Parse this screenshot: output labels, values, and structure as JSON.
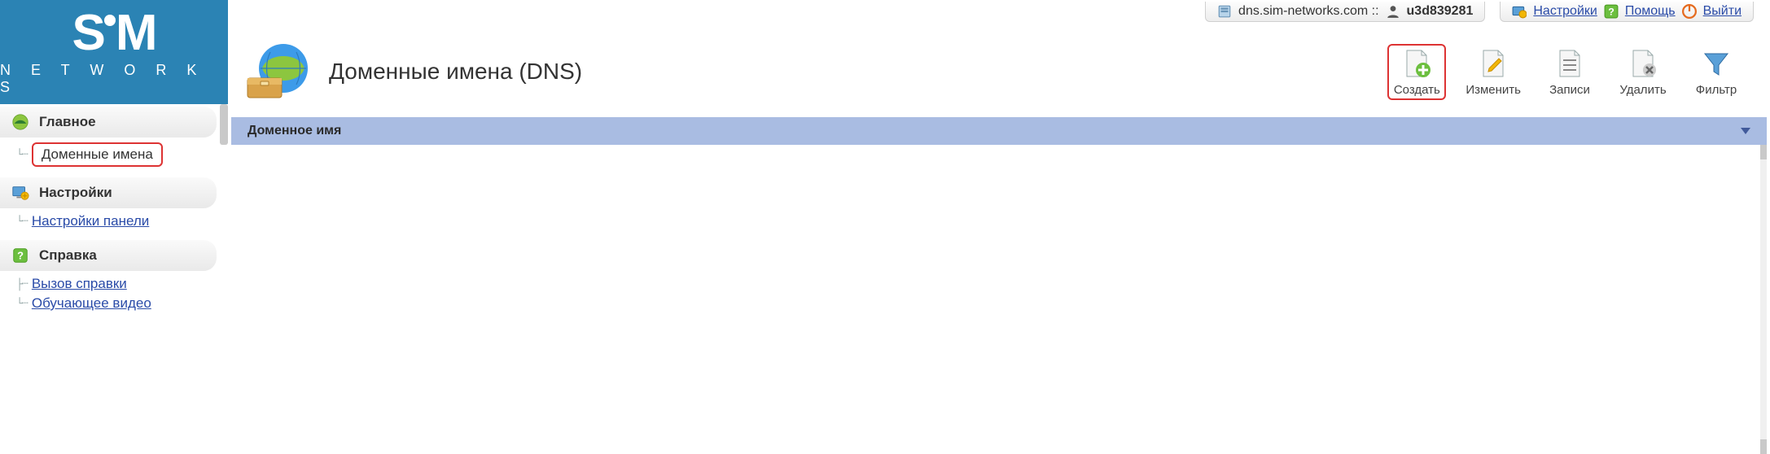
{
  "logo": {
    "top": "SM",
    "sub": "N E T W O R K S"
  },
  "topbar": {
    "host": "dns.sim-networks.com ::",
    "user_prefix": "",
    "user": "u3d839281",
    "settings": "Настройки",
    "help": "Помощь",
    "logout": "Выйти"
  },
  "nav": {
    "main": {
      "label": "Главное",
      "items": [
        {
          "label": "Доменные имена",
          "selected": true
        }
      ]
    },
    "settings": {
      "label": "Настройки",
      "items": [
        {
          "label": "Настройки панели"
        }
      ]
    },
    "help": {
      "label": "Справка",
      "items": [
        {
          "label": "Вызов справки"
        },
        {
          "label": "Обучающее видео"
        }
      ]
    }
  },
  "page": {
    "title": "Доменные имена (DNS)"
  },
  "toolbar": {
    "create": "Создать",
    "edit": "Изменить",
    "records": "Записи",
    "delete": "Удалить",
    "filter": "Фильтр"
  },
  "grid": {
    "col1": "Доменное имя"
  }
}
